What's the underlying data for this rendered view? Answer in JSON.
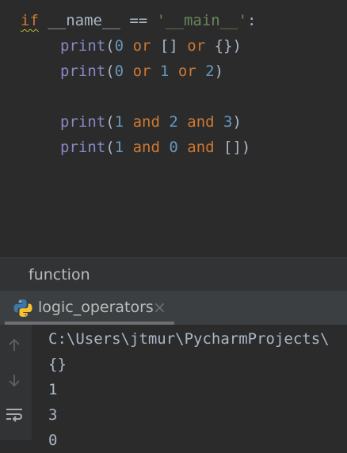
{
  "editor": {
    "lines": [
      {
        "kw_if": "if",
        "sp1": " ",
        "name": "__name__",
        "sp2": " ",
        "eq": "==",
        "sp3": " ",
        "str": "'__main__'",
        "colon": ":"
      },
      {
        "fn": "print",
        "lp": "(",
        "a": "0",
        "s1": " ",
        "op1": "or",
        "s2": " ",
        "b": "[]",
        "s3": " ",
        "op2": "or",
        "s4": " ",
        "c": "{}",
        "rp": ")"
      },
      {
        "fn": "print",
        "lp": "(",
        "a": "0",
        "s1": " ",
        "op1": "or",
        "s2": " ",
        "b": "1",
        "s3": " ",
        "op2": "or",
        "s4": " ",
        "c": "2",
        "rp": ")"
      },
      {
        "fn": "print",
        "lp": "(",
        "a": "1",
        "s1": " ",
        "op1": "and",
        "s2": " ",
        "b": "2",
        "s3": " ",
        "op2": "and",
        "s4": " ",
        "c": "3",
        "rp": ")"
      },
      {
        "fn": "print",
        "lp": "(",
        "a": "1",
        "s1": " ",
        "op1": "and",
        "s2": " ",
        "b": "0",
        "s3": " ",
        "op2": "and",
        "s4": " ",
        "c": "[]",
        "rp": ")"
      }
    ]
  },
  "breadcrumb": {
    "label": "function"
  },
  "run_panel": {
    "tab_label": "logic_operators",
    "close_symbol": "×",
    "icons": [
      "python-icon",
      "close-icon",
      "up-arrow-icon",
      "down-arrow-icon",
      "soft-wrap-icon"
    ]
  },
  "console": {
    "lines": [
      "C:\\Users\\jtmur\\PycharmProjects\\",
      "{}",
      "1",
      "3",
      "0"
    ]
  },
  "colors": {
    "background": "#2b2b2b",
    "keyword": "#cc7832",
    "builtin": "#8888c6",
    "number": "#6897bb",
    "string": "#6a8759",
    "text": "#a9b7c6"
  }
}
